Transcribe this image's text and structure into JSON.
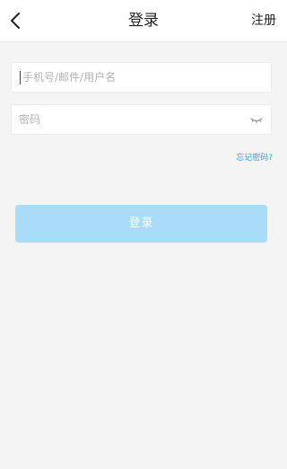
{
  "header": {
    "title": "登录",
    "register_label": "注册",
    "back_icon": "chevron-left-icon"
  },
  "form": {
    "account_placeholder": "手机号/邮件/用户名",
    "password_placeholder": "密码",
    "eye_icon": "eye-closed-icon",
    "forgot_label": "忘记密码?",
    "login_label": "登录"
  },
  "colors": {
    "accent": "#3aa0e0",
    "login_button_disabled": "#a9dcf6",
    "background": "#f4f4f5"
  }
}
